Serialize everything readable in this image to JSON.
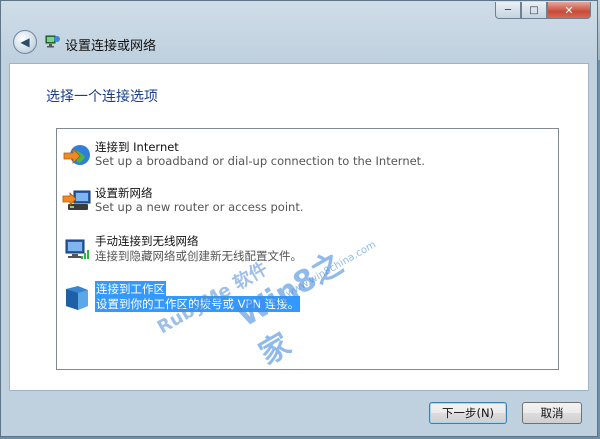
{
  "window": {
    "controls": {
      "minimize": "─",
      "maximize": "□",
      "close": "✕"
    }
  },
  "header": {
    "title": "设置连接或网络"
  },
  "main": {
    "instruction": "选择一个连接选项",
    "options": [
      {
        "title": "连接到 Internet",
        "description": "Set up a broadband or dial-up connection to the Internet.",
        "icon": "globe-icon"
      },
      {
        "title": "设置新网络",
        "description": "Set up a new router or access point.",
        "icon": "network-setup-icon"
      },
      {
        "title": "手动连接到无线网络",
        "description": "连接到隐藏网络或创建新无线配置文件。",
        "icon": "wireless-icon"
      },
      {
        "title": "连接到工作区",
        "description": "设置到你的工作区的拨号或 VPN 连接。",
        "icon": "workplace-icon"
      }
    ],
    "selected_index": 3
  },
  "watermark": {
    "brand_a": "RubyMe 软件",
    "brand_b": "Win8之家",
    "brand_c": "www.win8china.com"
  },
  "footer": {
    "next_label": "下一步(N)",
    "cancel_label": "取消"
  },
  "colors": {
    "selection": "#3399ff",
    "instruction": "#1a3f8a"
  }
}
